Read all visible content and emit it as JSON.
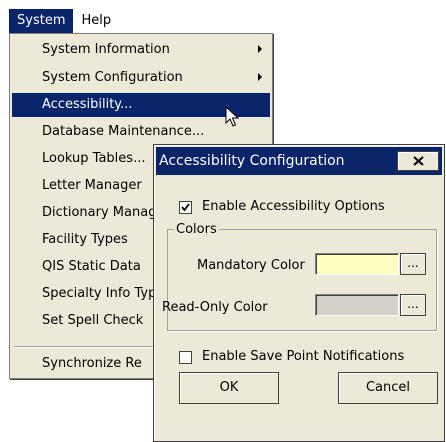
{
  "menubar": {
    "system": "System",
    "help": "Help"
  },
  "menu": {
    "items": [
      {
        "label": "System Information",
        "submenu": true
      },
      {
        "label": "System Configuration",
        "submenu": true
      },
      {
        "label": "Accessibility...",
        "highlighted": true
      },
      {
        "label": "Database Maintenance..."
      },
      {
        "label": "Lookup Tables..."
      },
      {
        "label": "Letter Manager"
      },
      {
        "label": "Dictionary Manager"
      },
      {
        "label": "Facility Types"
      },
      {
        "label": "QIS Static Data"
      },
      {
        "label": "Specialty Info Types"
      },
      {
        "label": "Set Spell Check"
      },
      {
        "label": "Synchronize Re"
      }
    ]
  },
  "dialog": {
    "title": "Accessibility Configuration",
    "enable_accessibility": {
      "label": "Enable Accessibility Options",
      "checked": true
    },
    "colors_group": "Colors",
    "mandatory_color": {
      "label": "Mandatory Color",
      "value": "#ffffc0",
      "button": "..."
    },
    "readonly_color": {
      "label": "Read-Only Color",
      "value": "#d4d0c8",
      "button": "..."
    },
    "enable_save_point": {
      "label": "Enable Save Point Notifications",
      "checked": false
    },
    "ok": "OK",
    "cancel": "Cancel"
  },
  "colors": {
    "highlight": "#0a246a",
    "face": "#ece9d8"
  },
  "icons": [
    "checkmark-icon",
    "close-icon",
    "submenu-arrow-icon",
    "mouse-cursor-icon"
  ]
}
